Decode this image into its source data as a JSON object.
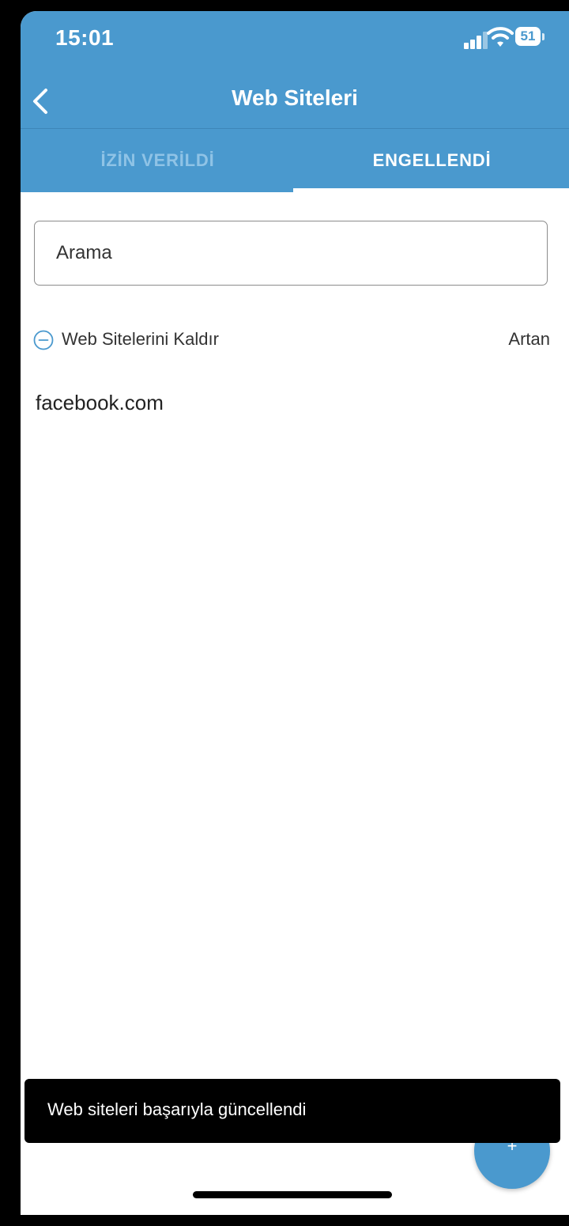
{
  "status_bar": {
    "time": "15:01",
    "battery": "51"
  },
  "header": {
    "title": "Web Siteleri"
  },
  "tabs": [
    {
      "label": "İZİN VERİLDİ",
      "active": false
    },
    {
      "label": "ENGELLENDİ",
      "active": true
    }
  ],
  "search": {
    "placeholder": "Arama"
  },
  "toolbar": {
    "remove_label": "Web Sitelerini Kaldır",
    "sort_label": "Artan"
  },
  "sites": [
    {
      "name": "facebook.com"
    }
  ],
  "toast": {
    "message": "Web siteleri başarıyla güncellendi"
  },
  "fab": {
    "label": "+"
  },
  "colors": {
    "accent": "#4a99ce",
    "inactive_tab": "#8fc3e6"
  }
}
